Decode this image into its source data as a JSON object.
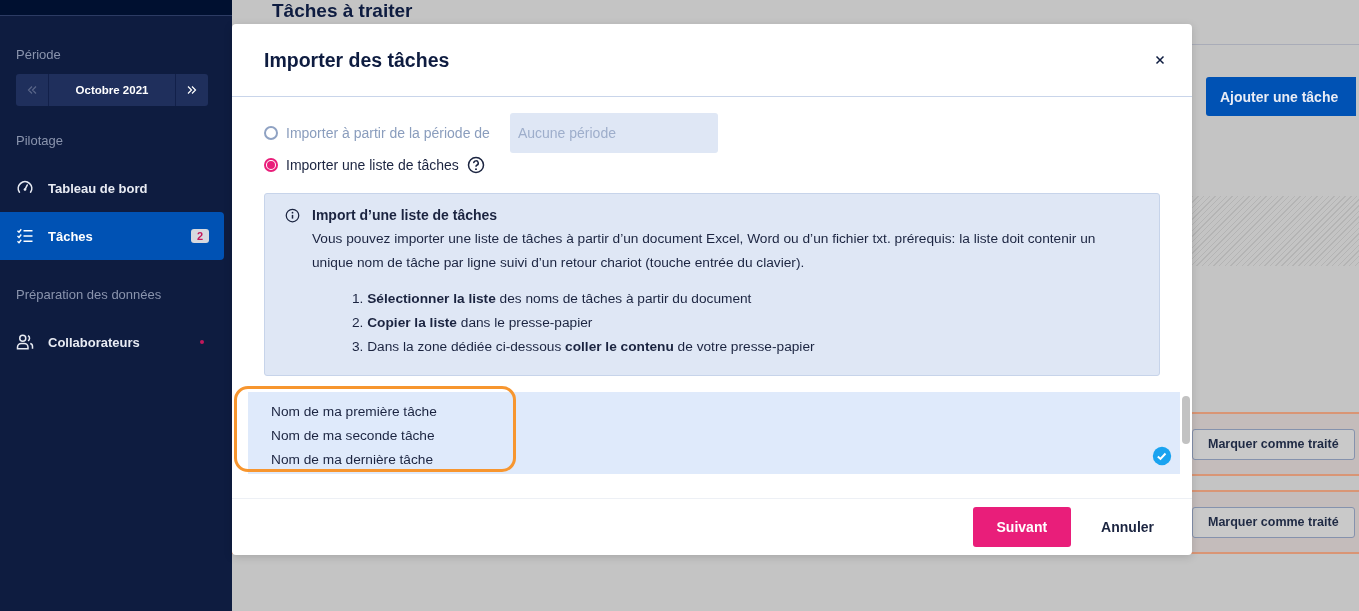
{
  "sidebar": {
    "period_heading": "Période",
    "period": {
      "value": "Octobre 2021",
      "prev_disabled": true,
      "next_disabled": false
    },
    "sections": [
      {
        "heading": "Pilotage",
        "items": [
          {
            "label": "Tableau de bord",
            "selected": false
          },
          {
            "label": "Tâches",
            "selected": true,
            "badge": "2"
          }
        ]
      },
      {
        "heading": "Préparation des données",
        "items": [
          {
            "label": "Collaborateurs",
            "selected": false,
            "notification": true
          }
        ]
      }
    ]
  },
  "main": {
    "title": "Tâches à traiter",
    "add_button": "Ajouter une tâche",
    "rows": [
      {
        "action": "Marquer comme traité"
      },
      {
        "action": "Marquer comme traité"
      }
    ]
  },
  "modal": {
    "title": "Importer des tâches",
    "options": [
      {
        "kind": "period",
        "label": "Importer à partir de la période de",
        "selected": false,
        "placeholder": "Aucune période"
      },
      {
        "kind": "help",
        "label": "Importer une liste de tâches",
        "selected": true
      }
    ],
    "info": {
      "title": "Import d’une liste de tâches",
      "text": "Vous pouvez importer une liste de tâches à partir d’un document Excel, Word ou d’un fichier txt. prérequis: la liste doit contenir un unique nom de tâche par ligne suivi d’un retour chariot (touche entrée du clavier).",
      "steps": [
        "1. **Sélectionner la liste** des noms de tâches à partir du document",
        "2. **Copier la liste** dans le presse-papier",
        "3. Dans la zone dédiée ci-dessous **coller le contenu** de votre presse-papier"
      ]
    },
    "input": {
      "value": [
        "Nom de ma première tâche",
        "Nom de ma seconde tâche",
        "Nom de ma dernière tâche"
      ],
      "valid": true,
      "highlighted": true
    },
    "buttons": [
      {
        "kind": "primary",
        "label": "Suivant"
      },
      {
        "kind": "link",
        "label": "Annuler"
      }
    ]
  }
}
